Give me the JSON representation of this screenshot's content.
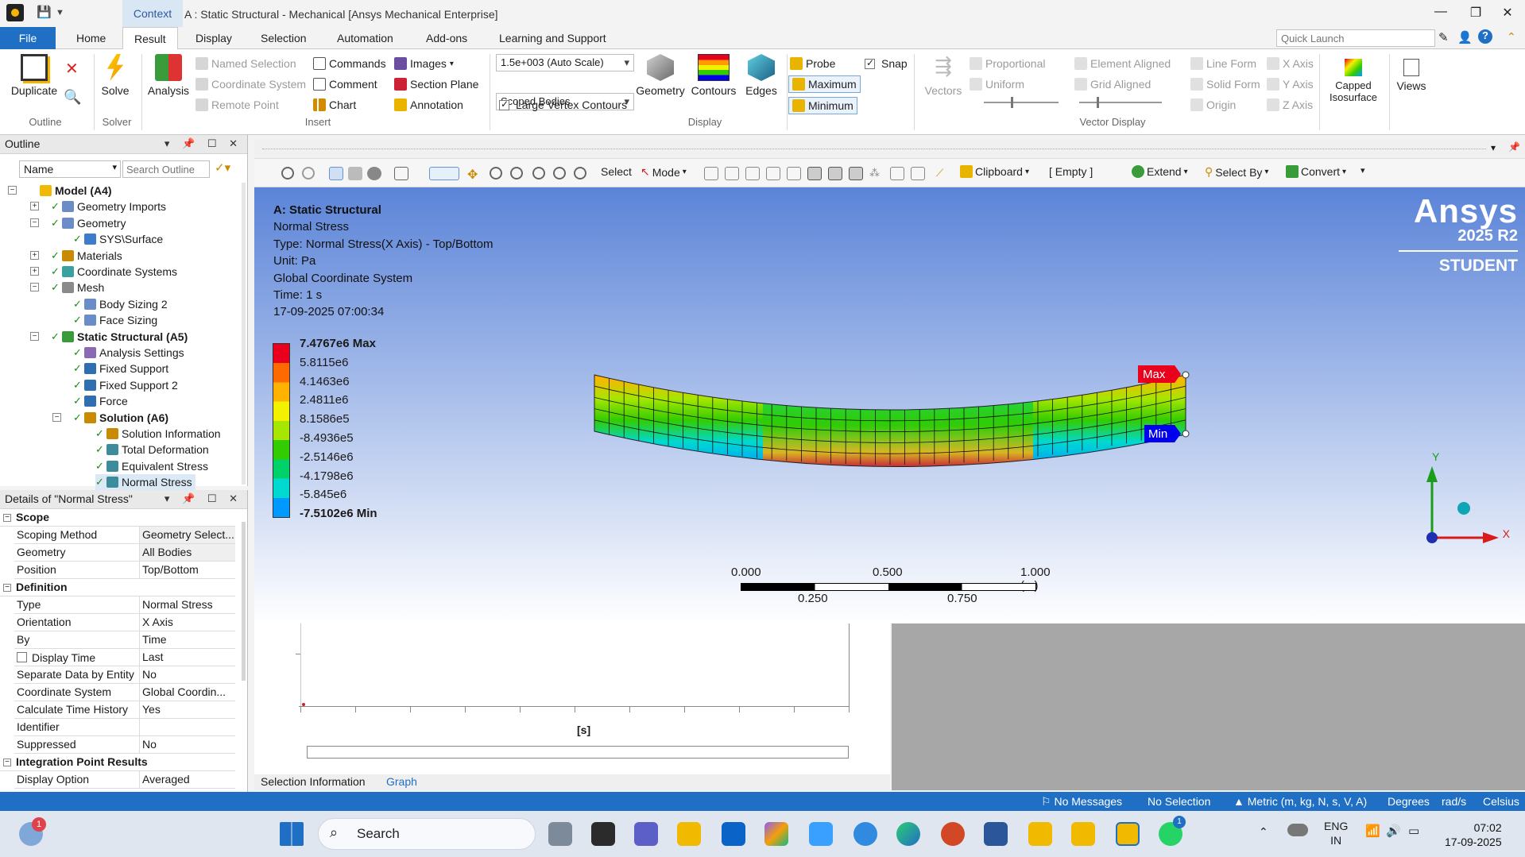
{
  "window": {
    "context_tab": "Context",
    "title": "A : Static Structural - Mechanical [Ansys Mechanical Enterprise]",
    "minimize": "—",
    "restore": "❐",
    "close": "✕"
  },
  "ribbon_tabs": {
    "file": "File",
    "tabs": [
      "Home",
      "Result",
      "Display",
      "Selection",
      "Automation",
      "Add-ons",
      "Learning and Support"
    ],
    "active": "Result",
    "quick_launch_placeholder": "Quick Launch"
  },
  "ribbon": {
    "outline_group": {
      "label": "Outline",
      "duplicate": "Duplicate"
    },
    "solver_group": {
      "label": "Solver",
      "solve": "Solve"
    },
    "insert_group": {
      "label": "Insert",
      "analysis": "Analysis",
      "named_selection": "Named Selection",
      "coordinate_system": "Coordinate System",
      "remote_point": "Remote Point",
      "commands": "Commands",
      "comment": "Comment",
      "chart": "Chart",
      "images": "Images",
      "section_plane": "Section Plane",
      "annotation": "Annotation"
    },
    "display_group": {
      "label": "Display",
      "scale": "1.5e+003 (Auto Scale)",
      "scoped": "Scoped Bodies",
      "large_vertex": "Large Vertex Contours",
      "geometry": "Geometry",
      "contours": "Contours",
      "edges": "Edges"
    },
    "probe_group": {
      "probe": "Probe",
      "maximum": "Maximum",
      "minimum": "Minimum",
      "snap": "Snap"
    },
    "vector_group": {
      "label": "Vector Display",
      "vectors": "Vectors",
      "proportional": "Proportional",
      "uniform": "Uniform",
      "element_aligned": "Element Aligned",
      "grid_aligned": "Grid Aligned",
      "line_form": "Line Form",
      "solid_form": "Solid Form",
      "origin": "Origin",
      "x_axis": "X Axis",
      "y_axis": "Y Axis",
      "z_axis": "Z Axis"
    },
    "capped": "Capped Isosurface",
    "views": "Views"
  },
  "outline": {
    "header": "Outline",
    "filter": "Name",
    "search_placeholder": "Search Outline",
    "items": [
      {
        "label": "Model (A4)",
        "level": 0,
        "bold": true
      },
      {
        "label": "Geometry Imports",
        "level": 1
      },
      {
        "label": "Geometry",
        "level": 1
      },
      {
        "label": "SYS\\Surface",
        "level": 2
      },
      {
        "label": "Materials",
        "level": 1
      },
      {
        "label": "Coordinate Systems",
        "level": 1
      },
      {
        "label": "Mesh",
        "level": 1
      },
      {
        "label": "Body Sizing 2",
        "level": 2
      },
      {
        "label": "Face Sizing",
        "level": 2
      },
      {
        "label": "Static Structural (A5)",
        "level": 1,
        "bold": true
      },
      {
        "label": "Analysis Settings",
        "level": 2
      },
      {
        "label": "Fixed Support",
        "level": 2
      },
      {
        "label": "Fixed Support 2",
        "level": 2
      },
      {
        "label": "Force",
        "level": 2
      },
      {
        "label": "Solution (A6)",
        "level": 2,
        "bold": true
      },
      {
        "label": "Solution Information",
        "level": 3
      },
      {
        "label": "Total Deformation",
        "level": 3
      },
      {
        "label": "Equivalent Stress",
        "level": 3
      },
      {
        "label": "Normal Stress",
        "level": 3,
        "selected": true
      }
    ]
  },
  "details": {
    "header": "Details of \"Normal Stress\"",
    "sections": {
      "scope": "Scope",
      "definition": "Definition",
      "integration": "Integration Point Results"
    },
    "rows": {
      "scoping_method": [
        "Scoping Method",
        "Geometry Select..."
      ],
      "geometry": [
        "Geometry",
        "All Bodies"
      ],
      "position": [
        "Position",
        "Top/Bottom"
      ],
      "type": [
        "Type",
        "Normal Stress"
      ],
      "orientation": [
        "Orientation",
        "X Axis"
      ],
      "by": [
        "By",
        "Time"
      ],
      "display_time": [
        "Display Time",
        "Last"
      ],
      "separate": [
        "Separate Data by Entity",
        "No"
      ],
      "coord": [
        "Coordinate System",
        "Global Coordin..."
      ],
      "time_history": [
        "Calculate Time History",
        "Yes"
      ],
      "identifier": [
        "Identifier",
        ""
      ],
      "suppressed": [
        "Suppressed",
        "No"
      ],
      "display_option": [
        "Display Option",
        "Averaged"
      ]
    }
  },
  "viewport_toolbar": {
    "select": "Select",
    "mode": "Mode",
    "clipboard": "Clipboard",
    "empty": "[ Empty ]",
    "extend": "Extend",
    "select_by": "Select By",
    "convert": "Convert"
  },
  "result": {
    "lines": [
      "A: Static Structural",
      "Normal Stress",
      "Type: Normal Stress(X Axis) - Top/Bottom",
      "Unit: Pa",
      "Global Coordinate System",
      "Time: 1 s",
      "17-09-2025 07:00:34"
    ],
    "legend": [
      {
        "label": "7.4767e6 Max",
        "color": "#e8001c"
      },
      {
        "label": "5.8115e6",
        "color": "#ff6a00"
      },
      {
        "label": "4.1463e6",
        "color": "#ffb300"
      },
      {
        "label": "2.4811e6",
        "color": "#f2f200"
      },
      {
        "label": "8.1586e5",
        "color": "#a6e600"
      },
      {
        "label": "-8.4936e5",
        "color": "#33cc00"
      },
      {
        "label": "-2.5146e6",
        "color": "#00d26a"
      },
      {
        "label": "-4.1798e6",
        "color": "#00d9d0"
      },
      {
        "label": "-5.845e6",
        "color": "#0099ff"
      },
      {
        "label": "-7.5102e6 Min",
        "color": "#0000ee"
      }
    ],
    "max_tag": "Max",
    "min_tag": "Min",
    "scale": {
      "t0": "0.000",
      "t1": "0.500",
      "t2": "1.000 (m)",
      "b1": "0.250",
      "b2": "0.750"
    },
    "axes": {
      "x": "X",
      "y": "Y"
    }
  },
  "logo": {
    "name": "Ansys",
    "version": "2025 R2",
    "edition": "STUDENT"
  },
  "graph": {
    "xlabel": "[s]"
  },
  "bottom_tabs": [
    "Selection Information",
    "Graph"
  ],
  "status": {
    "messages": "No Messages",
    "selection": "No Selection",
    "units": "Metric (m, kg, N, s, V, A)",
    "degrees": "Degrees",
    "rads": "rad/s",
    "temp": "Celsius"
  },
  "taskbar": {
    "search": "Search",
    "lang1": "ENG",
    "lang2": "IN",
    "time": "07:02",
    "date": "17-09-2025",
    "notif_count": "1",
    "whatsapp_count": "1"
  }
}
